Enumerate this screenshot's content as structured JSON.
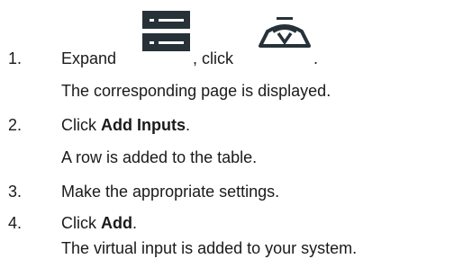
{
  "steps": [
    {
      "number": "1.",
      "prefix": "Expand",
      "middle": ", click",
      "suffix": ".",
      "result": "The corresponding page is displayed."
    },
    {
      "number": "2.",
      "prefix": "Click ",
      "bold": "Add Inputs",
      "suffix": ".",
      "result": "A row is added to the table."
    },
    {
      "number": "3.",
      "text": "Make the appropriate settings."
    },
    {
      "number": "4.",
      "prefix": "Click ",
      "bold": "Add",
      "suffix": ".",
      "result": "The virtual input is added to your system."
    }
  ],
  "icons": {
    "expand_icon": "server-rack-icon",
    "click_icon": "virtual-input-icon"
  },
  "colors": {
    "text": "#1a1a1a",
    "icon_dark": "#263238"
  }
}
